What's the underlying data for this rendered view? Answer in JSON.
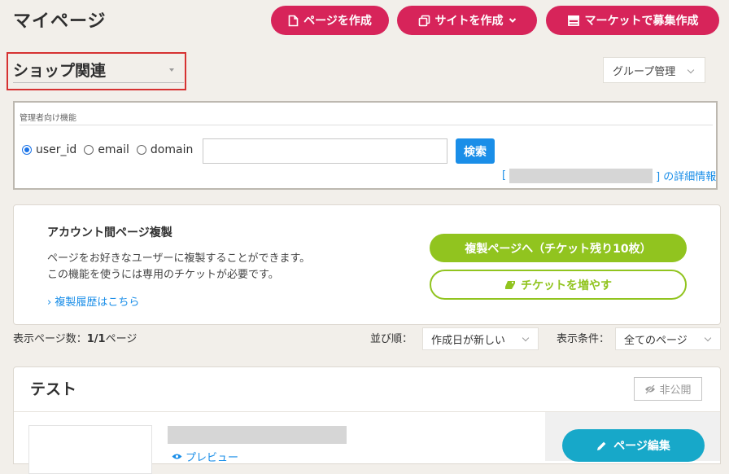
{
  "header": {
    "title": "マイページ",
    "buttons": {
      "create_page": "ページを作成",
      "create_site": "サイトを作成",
      "market": "マーケットで募集作成"
    },
    "brand_color": "#d7245a"
  },
  "group": {
    "selected": "ショップ関連",
    "manage_label": "グループ管理"
  },
  "admin": {
    "title": "管理者向け機能",
    "radios": [
      {
        "label": "user_id",
        "checked": true
      },
      {
        "label": "email",
        "checked": false
      },
      {
        "label": "domain",
        "checked": false
      }
    ],
    "search_value": "",
    "search_button": "検索",
    "detail_prefix": "[",
    "detail_suffix": "] の詳細情報"
  },
  "copy_panel": {
    "title": "アカウント間ページ複製",
    "desc_line1": "ページをお好きなユーザーに複製することができます。",
    "desc_line2": "この機能を使うには専用のチケットが必要です。",
    "history_link": "› 複製履歴はこちら",
    "copy_button": "複製ページへ（チケット残り10枚）",
    "ticket_button": "チケットを増やす",
    "accent_color": "#91c41f"
  },
  "filters": {
    "count_label": "表示ページ数：",
    "count_value": "1/1",
    "count_unit": "ページ",
    "sort_label": "並び順：",
    "sort_value": "作成日が新しい",
    "filter_label": "表示条件：",
    "filter_value": "全てのページ"
  },
  "page_card": {
    "title": "テスト",
    "badge": "非公開",
    "preview_link": "プレビュー",
    "edit_button": "ページ編集",
    "edit_color": "#17a8c9"
  }
}
